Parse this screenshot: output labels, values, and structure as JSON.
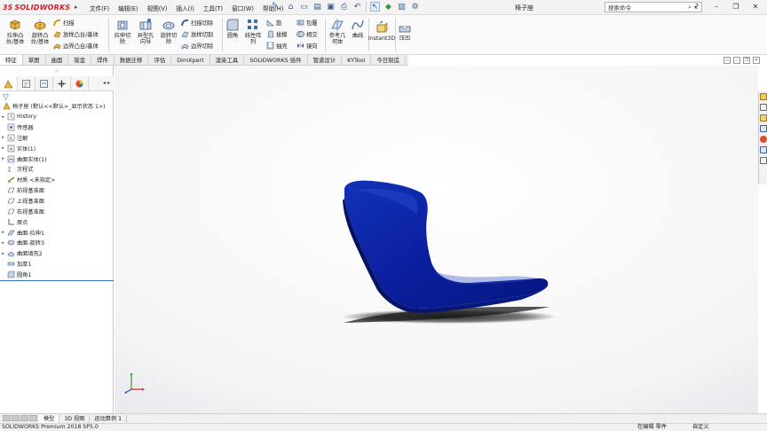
{
  "app": {
    "logo_ds": "3S",
    "logo_name": "SOLIDWORKS",
    "doc_title": "椅子座"
  },
  "menu": [
    "文件(F)",
    "编辑(E)",
    "视图(V)",
    "插入(I)",
    "工具(T)",
    "窗口(W)",
    "帮助(H)"
  ],
  "search": {
    "placeholder": "搜索命令"
  },
  "ribbon": {
    "extrude_boss": "拉伸凸\n台/基体",
    "revolve_boss": "旋转凸\n台/基体",
    "sweep": "扫描",
    "loft_boss": "放样凸台/基体",
    "boundary_boss": "边界凸台/基体",
    "extrude_cut": "拉伸切\n除",
    "hole_wizard": "异型孔\n向导",
    "revolve_cut": "旋转切\n除",
    "swept_cut": "扫描切除",
    "lofted_cut": "放样切割",
    "boundary_cut": "边界切除",
    "fillet": "圆角",
    "linear_pattern": "线性阵\n列",
    "rib": "筋",
    "wrap": "包覆",
    "draft": "拔模",
    "intersect": "相交",
    "shell": "抽壳",
    "mirror": "镜向",
    "ref_geometry": "参考几\n何体",
    "curves": "曲线",
    "instant3d": "Instant3D",
    "rapid": "压凹"
  },
  "tabs": [
    "特征",
    "草图",
    "曲面",
    "钣金",
    "焊件",
    "数据迁移",
    "评估",
    "DimXpert",
    "渲染工具",
    "SOLIDWORKS 插件",
    "管道设计",
    "KYTool",
    "今日制造"
  ],
  "tree": {
    "root": "椅子座  (默认<<默认>_显示状态 1>)",
    "items": [
      {
        "label": "History",
        "arrow": "▸",
        "icon": "history-icon"
      },
      {
        "label": "传感器",
        "arrow": "",
        "icon": "sensor-icon"
      },
      {
        "label": "注解",
        "arrow": "▸",
        "icon": "annotation-icon"
      },
      {
        "label": "实体(1)",
        "arrow": "▸",
        "icon": "solid-body-icon"
      },
      {
        "label": "曲面实体(1)",
        "arrow": "▸",
        "icon": "surface-body-icon"
      },
      {
        "label": "方程式",
        "arrow": "",
        "icon": "equation-icon"
      },
      {
        "label": "材质 <未指定>",
        "arrow": "",
        "icon": "material-icon"
      },
      {
        "label": "前视基准面",
        "arrow": "",
        "icon": "plane-icon"
      },
      {
        "label": "上视基准面",
        "arrow": "",
        "icon": "plane-icon"
      },
      {
        "label": "右视基准面",
        "arrow": "",
        "icon": "plane-icon"
      },
      {
        "label": "原点",
        "arrow": "",
        "icon": "origin-icon"
      },
      {
        "label": "曲面-拉伸1",
        "arrow": "▸",
        "icon": "surface-extrude-icon"
      },
      {
        "label": "曲面-旋转3",
        "arrow": "▸",
        "icon": "surface-revolve-icon"
      },
      {
        "label": "曲面填充2",
        "arrow": "▸",
        "icon": "surface-fill-icon"
      },
      {
        "label": "加厚1",
        "arrow": "",
        "icon": "thicken-icon"
      },
      {
        "label": "圆角1",
        "arrow": "",
        "icon": "fillet-feature-icon"
      }
    ]
  },
  "bottom_tabs": [
    "模型",
    "3D 视图",
    "运动算例 1"
  ],
  "status": {
    "left": "SOLIDWORKS Premium 2018 SP5.0",
    "mode": "在编辑 零件",
    "units": "自定义"
  },
  "colors": {
    "model_blue": "#0a1f9e",
    "accent": "#3a6fb6",
    "brand_red": "#d12027"
  }
}
